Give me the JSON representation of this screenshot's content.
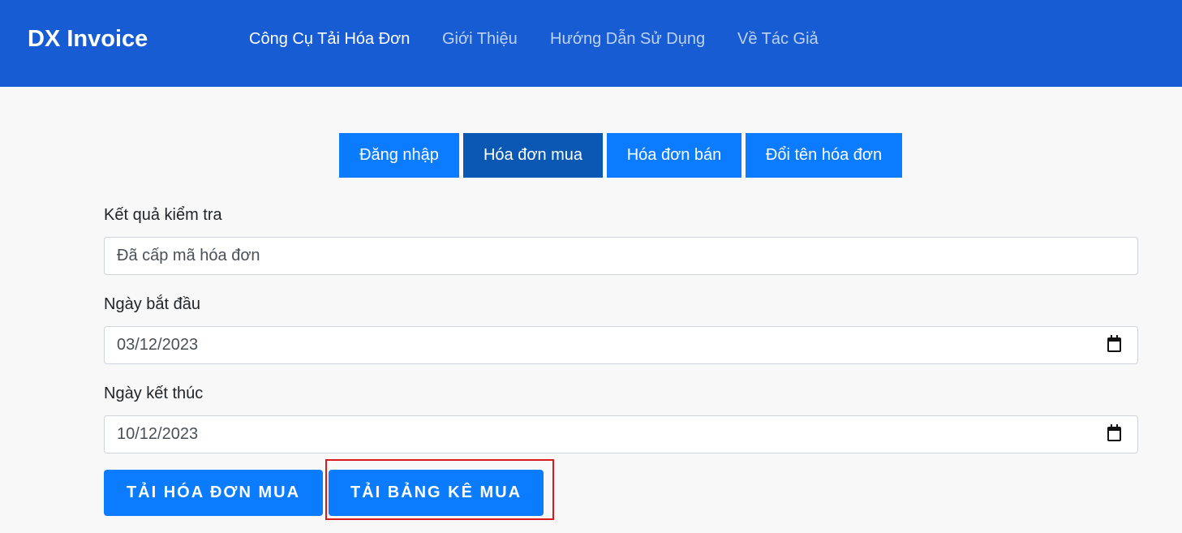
{
  "navbar": {
    "brand": "DX Invoice",
    "links": [
      {
        "label": "Công Cụ Tải Hóa Đơn",
        "active": true
      },
      {
        "label": "Giới Thiệu",
        "active": false
      },
      {
        "label": "Hướng Dẫn Sử Dụng",
        "active": false
      },
      {
        "label": "Về Tác Giả",
        "active": false
      }
    ]
  },
  "tabs": [
    {
      "label": "Đăng nhập",
      "active": false
    },
    {
      "label": "Hóa đơn mua",
      "active": true
    },
    {
      "label": "Hóa đơn bán",
      "active": false
    },
    {
      "label": "Đổi tên hóa đơn",
      "active": false
    }
  ],
  "form": {
    "check_result": {
      "label": "Kết quả kiểm tra",
      "value": "Đã cấp mã hóa đơn"
    },
    "start_date": {
      "label": "Ngày bắt đầu",
      "value": "03/12/2023"
    },
    "end_date": {
      "label": "Ngày kết thúc",
      "value": "10/12/2023"
    }
  },
  "actions": {
    "download_invoices": "TẢI HÓA ĐƠN MUA",
    "download_list": "TẢI BẢNG KÊ MUA"
  },
  "colors": {
    "navbar": "#175cd3",
    "primary": "#0b7cff",
    "tab_active": "#0a58b4",
    "highlight": "#d7191c"
  },
  "icons": [
    "calendar-icon"
  ]
}
